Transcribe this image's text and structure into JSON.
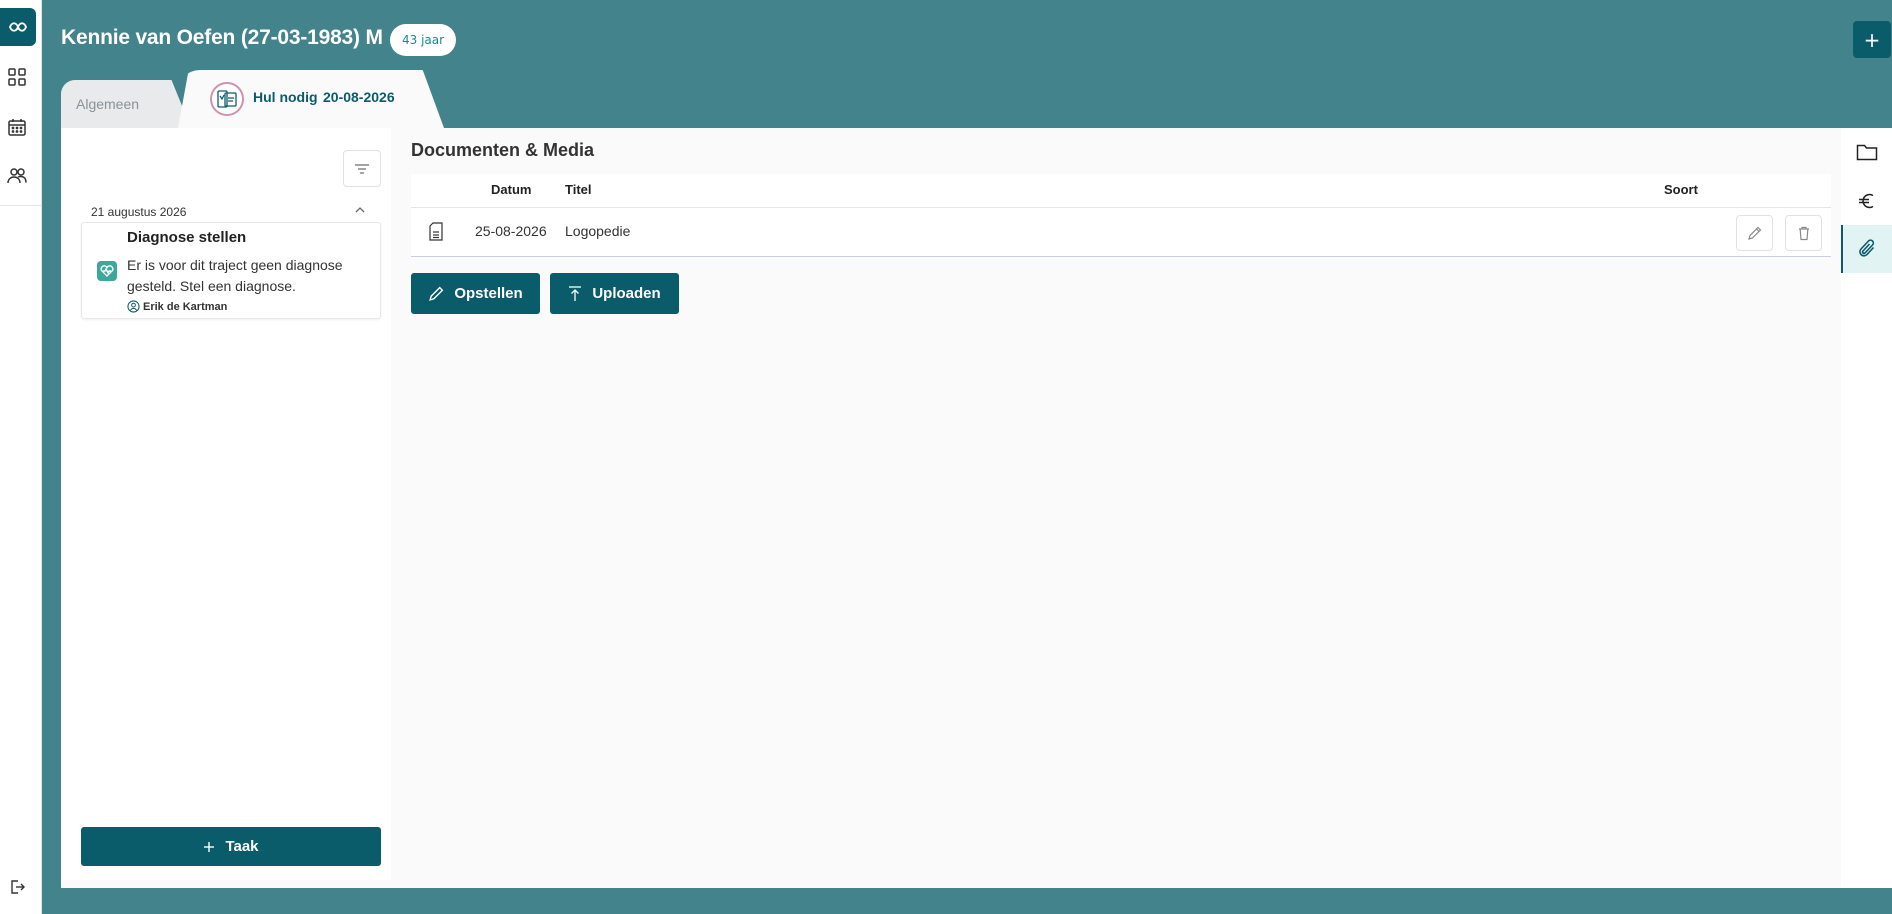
{
  "app": {
    "accent": "#0b5c6b",
    "header_bg": "#43838b"
  },
  "rail": {
    "icons": [
      "app-logo-icon",
      "dashboard-grid-icon",
      "calendar-icon",
      "users-icon",
      "logout-icon"
    ]
  },
  "header": {
    "patient": "Kennie van Oefen (27-03-1983) M",
    "age": "43 jaar",
    "add_icon": "+"
  },
  "tabs": {
    "general": "Algemeen",
    "active_label": "Hul nodig",
    "active_date": "20-08-2026"
  },
  "tasks": {
    "group_date": "21 augustus 2026",
    "card": {
      "title": "Diagnose stellen",
      "description": "Er is voor dit traject geen diagnose gesteld. Stel een diagnose.",
      "user": "Erik de Kartman"
    },
    "add_button": "Taak"
  },
  "documents": {
    "title": "Documenten & Media",
    "columns": {
      "date": "Datum",
      "title": "Titel",
      "type": "Soort"
    },
    "rows": [
      {
        "date": "25-08-2026",
        "title": "Logopedie",
        "type": ""
      }
    ],
    "compose_button": "Opstellen",
    "upload_button": "Uploaden"
  },
  "siderail": {
    "icons": [
      "folder-icon",
      "euro-icon",
      "paperclip-icon"
    ],
    "active": "paperclip-icon"
  }
}
